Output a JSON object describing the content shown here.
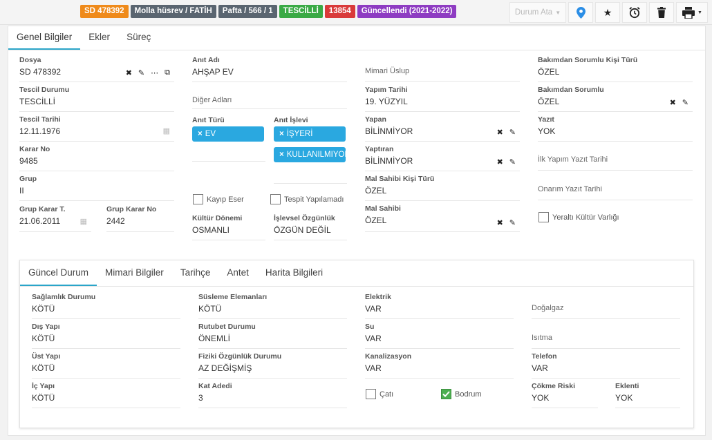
{
  "badges": [
    {
      "text": "SD 478392",
      "color": "#ef8a1a"
    },
    {
      "text": "Molla hüsrev / FATİH",
      "color": "#5a6570"
    },
    {
      "text": "Pafta / 566 / 1",
      "color": "#5a6570"
    },
    {
      "text": "TESCİLLİ",
      "color": "#3aaa45"
    },
    {
      "text": "13854",
      "color": "#d93a3a"
    },
    {
      "text": "Güncellendi (2021-2022)",
      "color": "#8e3cc2"
    }
  ],
  "toolbar": {
    "status_dropdown": "Durum Ata",
    "icons": [
      "map-marker-icon",
      "star-icon",
      "alarm-clock-icon",
      "trash-icon",
      "printer-icon"
    ]
  },
  "main_tabs": [
    "Genel Bilgiler",
    "Ekler",
    "Süreç"
  ],
  "col1": {
    "dosya": {
      "label": "Dosya",
      "value": "SD 478392"
    },
    "tescil_durumu": {
      "label": "Tescil Durumu",
      "value": "TESCİLLİ"
    },
    "tescil_tarihi": {
      "label": "Tescil Tarihi",
      "value": "12.11.1976"
    },
    "karar_no": {
      "label": "Karar No",
      "value": "9485"
    },
    "grup": {
      "label": "Grup",
      "value": "II"
    },
    "grup_karar_t": {
      "label": "Grup Karar T.",
      "value": "21.06.2011"
    },
    "grup_karar_no": {
      "label": "Grup Karar No",
      "value": "2442"
    }
  },
  "col2": {
    "anit_adi": {
      "label": "Anıt Adı",
      "value": "AHŞAP EV"
    },
    "diger_adlari": "Diğer Adları",
    "anit_turu": {
      "label": "Anıt Türü",
      "chips": [
        "EV"
      ]
    },
    "anit_islevi": {
      "label": "Anıt İşlevi",
      "chips": [
        "İŞYERİ",
        "KULLANILMIYOR"
      ]
    },
    "kayip_eser": "Kayıp Eser",
    "tespit_yapilamadi": "Tespit Yapılamadı",
    "kultur_donemi": {
      "label": "Kültür Dönemi",
      "value": "OSMANLI"
    },
    "islevsel_ozgunluk": {
      "label": "İşlevsel Özgünlük",
      "value": "ÖZGÜN DEĞİL"
    }
  },
  "col3": {
    "mimari_uslup": "Mimari Üslup",
    "yapim_tarihi": {
      "label": "Yapım Tarihi",
      "value": "19. YÜZYIL"
    },
    "yapan": {
      "label": "Yapan",
      "value": "BİLİNMİYOR"
    },
    "yaptiran": {
      "label": "Yaptıran",
      "value": "BİLİNMİYOR"
    },
    "mal_sahibi_kisi_turu": {
      "label": "Mal Sahibi Kişi Türü",
      "value": "ÖZEL"
    },
    "mal_sahibi": {
      "label": "Mal Sahibi",
      "value": "ÖZEL"
    }
  },
  "col4": {
    "bakimdan_sorumlu_kisi_turu": {
      "label": "Bakımdan Sorumlu Kişi Türü",
      "value": "ÖZEL"
    },
    "bakimdan_sorumlu": {
      "label": "Bakımdan Sorumlu",
      "value": "ÖZEL"
    },
    "yazit": {
      "label": "Yazıt",
      "value": "YOK"
    },
    "ilk_yapim_yazit_tarihi": "İlk Yapım Yazıt Tarihi",
    "onarim_yazit_tarihi": "Onarım Yazıt Tarihi",
    "yeralti": "Yeraltı Kültür Varlığı"
  },
  "inner_tabs": [
    "Güncel Durum",
    "Mimari Bilgiler",
    "Tarihçe",
    "Antet",
    "Harita Bilgileri"
  ],
  "inner": {
    "saglamlik": {
      "label": "Sağlamlık Durumu",
      "value": "KÖTÜ"
    },
    "dis_yapi": {
      "label": "Dış Yapı",
      "value": "KÖTÜ"
    },
    "ust_yapi": {
      "label": "Üst Yapı",
      "value": "KÖTÜ"
    },
    "ic_yapi": {
      "label": "İç Yapı",
      "value": "KÖTÜ"
    },
    "susleme": {
      "label": "Süsleme Elemanları",
      "value": "KÖTÜ"
    },
    "rutubet": {
      "label": "Rutubet Durumu",
      "value": "ÖNEMLİ"
    },
    "fiziki": {
      "label": "Fiziki Özgünlük Durumu",
      "value": "AZ DEĞİŞMİŞ"
    },
    "kat_adedi": {
      "label": "Kat Adedi",
      "value": "3"
    },
    "elektrik": {
      "label": "Elektrik",
      "value": "VAR"
    },
    "su": {
      "label": "Su",
      "value": "VAR"
    },
    "kanalizasyon": {
      "label": "Kanalizasyon",
      "value": "VAR"
    },
    "cati": {
      "label": "Çatı",
      "checked": false
    },
    "bodrum": {
      "label": "Bodrum",
      "checked": true
    },
    "dogalgaz": "Doğalgaz",
    "isitma": "Isıtma",
    "telefon": {
      "label": "Telefon",
      "value": "VAR"
    },
    "cokme_riski": {
      "label": "Çökme Riski",
      "value": "YOK"
    },
    "eklenti": {
      "label": "Eklenti",
      "value": "YOK"
    }
  },
  "colors": {
    "accent": "#2aa5c9",
    "chip": "#2aa8e0",
    "check_on": "#4caf50"
  }
}
